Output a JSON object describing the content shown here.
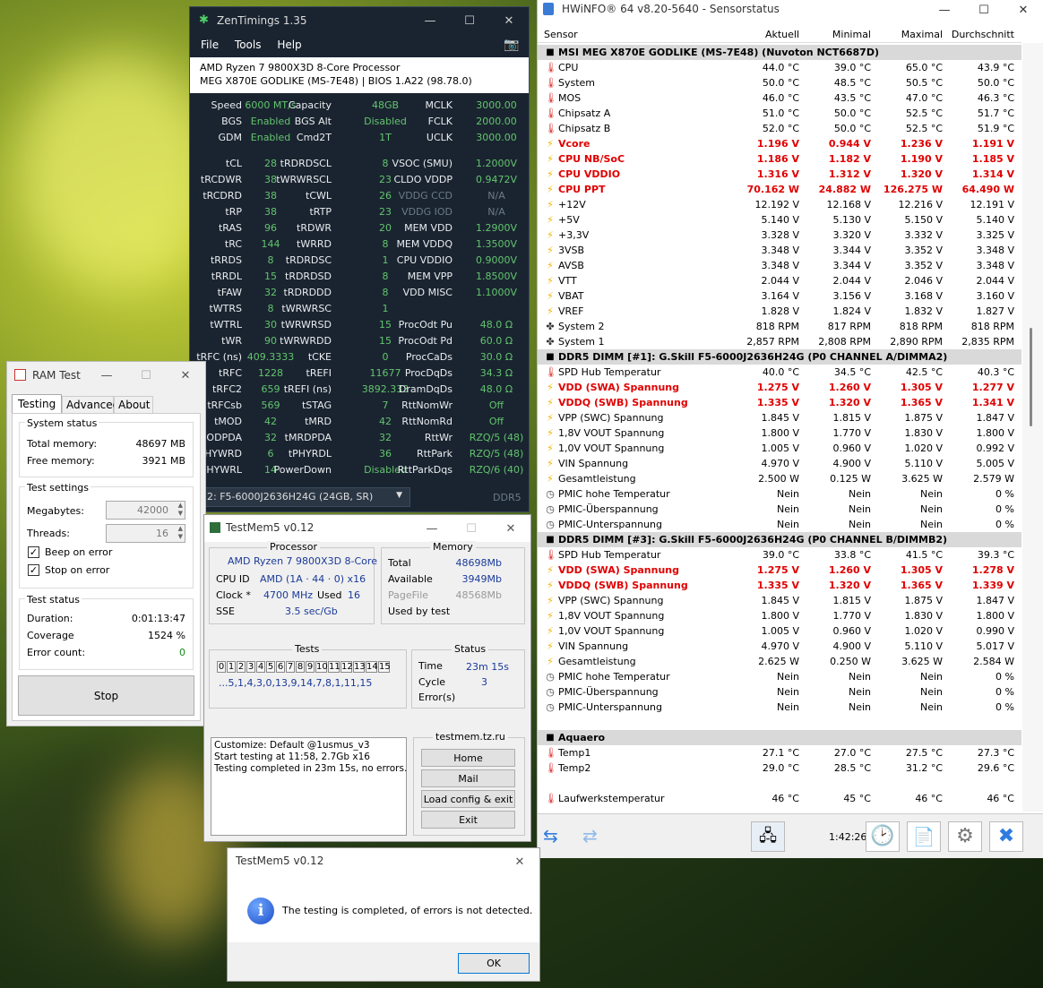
{
  "zen": {
    "title": "ZenTimings 1.35",
    "menu": [
      "File",
      "Tools",
      "Help"
    ],
    "cpu": "AMD Ryzen 7 9800X3D 8-Core Processor",
    "board": "MEG X870E GODLIKE (MS-7E48) | BIOS 1.A22 (98.78.0)",
    "top": [
      [
        "Speed",
        "6000 MT/s",
        "Capacity",
        "48GB",
        "MCLK",
        "3000.00"
      ],
      [
        "BGS",
        "Enabled",
        "BGS Alt",
        "Disabled",
        "FCLK",
        "2000.00"
      ],
      [
        "GDM",
        "Enabled",
        "Cmd2T",
        "1T",
        "UCLK",
        "3000.00"
      ]
    ],
    "timings": [
      [
        "tCL",
        "28",
        "tRDRDSCL",
        "8",
        "VSOC (SMU)",
        "1.2000V"
      ],
      [
        "tRCDWR",
        "38",
        "tWRWRSCL",
        "23",
        "CLDO VDDP",
        "0.9472V"
      ],
      [
        "tRCDRD",
        "38",
        "tCWL",
        "26",
        "VDDG CCD",
        "N/A"
      ],
      [
        "tRP",
        "38",
        "tRTP",
        "23",
        "VDDG IOD",
        "N/A"
      ],
      [
        "tRAS",
        "96",
        "tRDWR",
        "20",
        "MEM VDD",
        "1.2900V"
      ],
      [
        "tRC",
        "144",
        "tWRRD",
        "8",
        "MEM VDDQ",
        "1.3500V"
      ],
      [
        "tRRDS",
        "8",
        "tRDRDSC",
        "1",
        "CPU VDDIO",
        "0.9000V"
      ],
      [
        "tRRDL",
        "15",
        "tRDRDSD",
        "8",
        "MEM VPP",
        "1.8500V"
      ],
      [
        "tFAW",
        "32",
        "tRDRDDD",
        "8",
        "VDD MISC",
        "1.1000V"
      ],
      [
        "tWTRS",
        "8",
        "tWRWRSC",
        "1",
        "",
        ""
      ],
      [
        "tWTRL",
        "30",
        "tWRWRSD",
        "15",
        "ProcOdt Pu",
        "48.0 Ω"
      ],
      [
        "tWR",
        "90",
        "tWRWRDD",
        "15",
        "ProcOdt Pd",
        "60.0 Ω"
      ],
      [
        "tRFC (ns)",
        "409.3333",
        "tCKE",
        "0",
        "ProcCaDs",
        "30.0 Ω"
      ],
      [
        "tRFC",
        "1228",
        "tREFI",
        "11677",
        "ProcDqDs",
        "34.3 Ω"
      ],
      [
        "tRFC2",
        "659",
        "tREFI (ns)",
        "3892.333",
        "DramDqDs",
        "48.0 Ω"
      ],
      [
        "tRFCsb",
        "569",
        "tSTAG",
        "7",
        "RttNomWr",
        "Off"
      ],
      [
        "tMOD",
        "42",
        "tMRD",
        "42",
        "RttNomRd",
        "Off"
      ],
      [
        "tMODPDA",
        "32",
        "tMRDPDA",
        "32",
        "RttWr",
        "RZQ/5 (48)"
      ],
      [
        "tPHYWRD",
        "6",
        "tPHYRDL",
        "36",
        "RttPark",
        "RZQ/5 (48)"
      ],
      [
        "tPHYWRL",
        "14",
        "PowerDown",
        "Disabled",
        "RttParkDqs",
        "RZQ/6 (40)"
      ]
    ],
    "dimm": "2: F5-6000J2636H24G (24GB, SR)",
    "ddr": "DDR5"
  },
  "hw": {
    "title": "HWiNFO® 64 v8.20-5640 - Sensorstatus",
    "cols": [
      "Sensor",
      "Aktuell",
      "Minimal",
      "Maximal",
      "Durchschnitt"
    ],
    "rows": [
      [
        "sec",
        "",
        "MSI MEG X870E GODLIKE (MS-7E48) (Nuvoton NCT6687D)",
        "",
        "",
        "",
        ""
      ],
      [
        "t",
        "therm",
        "CPU",
        "44.0 °C",
        "39.0 °C",
        "65.0 °C",
        "43.9 °C"
      ],
      [
        "t",
        "therm",
        "System",
        "50.0 °C",
        "48.5 °C",
        "50.5 °C",
        "50.0 °C"
      ],
      [
        "t",
        "therm",
        "MOS",
        "46.0 °C",
        "43.5 °C",
        "47.0 °C",
        "46.3 °C"
      ],
      [
        "t",
        "therm",
        "Chipsatz A",
        "51.0 °C",
        "50.0 °C",
        "52.5 °C",
        "51.7 °C"
      ],
      [
        "t",
        "therm",
        "Chipsatz B",
        "52.0 °C",
        "50.0 °C",
        "52.5 °C",
        "51.9 °C"
      ],
      [
        "red",
        "bolt",
        "Vcore",
        "1.196 V",
        "0.944 V",
        "1.236 V",
        "1.191 V"
      ],
      [
        "red",
        "bolt",
        "CPU NB/SoC",
        "1.186 V",
        "1.182 V",
        "1.190 V",
        "1.185 V"
      ],
      [
        "red",
        "bolt",
        "CPU VDDIO",
        "1.316 V",
        "1.312 V",
        "1.320 V",
        "1.314 V"
      ],
      [
        "red",
        "bolt",
        "CPU PPT",
        "70.162 W",
        "24.882 W",
        "126.275 W",
        "64.490 W"
      ],
      [
        "t",
        "bolt",
        "+12V",
        "12.192 V",
        "12.168 V",
        "12.216 V",
        "12.191 V"
      ],
      [
        "t",
        "bolt",
        "+5V",
        "5.140 V",
        "5.130 V",
        "5.150 V",
        "5.140 V"
      ],
      [
        "t",
        "bolt",
        "+3,3V",
        "3.328 V",
        "3.320 V",
        "3.332 V",
        "3.325 V"
      ],
      [
        "t",
        "bolt",
        "3VSB",
        "3.348 V",
        "3.344 V",
        "3.352 V",
        "3.348 V"
      ],
      [
        "t",
        "bolt",
        "AVSB",
        "3.348 V",
        "3.344 V",
        "3.352 V",
        "3.348 V"
      ],
      [
        "t",
        "bolt",
        "VTT",
        "2.044 V",
        "2.044 V",
        "2.046 V",
        "2.044 V"
      ],
      [
        "t",
        "bolt",
        "VBAT",
        "3.164 V",
        "3.156 V",
        "3.168 V",
        "3.160 V"
      ],
      [
        "t",
        "bolt",
        "VREF",
        "1.828 V",
        "1.824 V",
        "1.832 V",
        "1.827 V"
      ],
      [
        "t",
        "fan",
        "System 2",
        "818 RPM",
        "817 RPM",
        "818 RPM",
        "818 RPM"
      ],
      [
        "t",
        "fan",
        "System 1",
        "2,857 RPM",
        "2,808 RPM",
        "2,890 RPM",
        "2,835 RPM"
      ],
      [
        "sec",
        "",
        "DDR5 DIMM [#1]: G.Skill F5-6000J2636H24G (P0 CHANNEL A/DIMMA2)",
        "",
        "",
        "",
        ""
      ],
      [
        "t",
        "therm",
        "SPD Hub Temperatur",
        "40.0 °C",
        "34.5 °C",
        "42.5 °C",
        "40.3 °C"
      ],
      [
        "red",
        "bolt",
        "VDD (SWA) Spannung",
        "1.275 V",
        "1.260 V",
        "1.305 V",
        "1.277 V"
      ],
      [
        "red",
        "bolt",
        "VDDQ (SWB) Spannung",
        "1.335 V",
        "1.320 V",
        "1.365 V",
        "1.341 V"
      ],
      [
        "t",
        "bolt",
        "VPP (SWC) Spannung",
        "1.845 V",
        "1.815 V",
        "1.875 V",
        "1.847 V"
      ],
      [
        "t",
        "bolt",
        "1,8V VOUT Spannung",
        "1.800 V",
        "1.770 V",
        "1.830 V",
        "1.800 V"
      ],
      [
        "t",
        "bolt",
        "1,0V VOUT Spannung",
        "1.005 V",
        "0.960 V",
        "1.020 V",
        "0.992 V"
      ],
      [
        "t",
        "bolt",
        "VIN Spannung",
        "4.970 V",
        "4.900 V",
        "5.110 V",
        "5.005 V"
      ],
      [
        "t",
        "bolt",
        "Gesamtleistung",
        "2.500 W",
        "0.125 W",
        "3.625 W",
        "2.579 W"
      ],
      [
        "t",
        "clock",
        "PMIC hohe Temperatur",
        "Nein",
        "Nein",
        "Nein",
        "0 %"
      ],
      [
        "t",
        "clock",
        "PMIC-Überspannung",
        "Nein",
        "Nein",
        "Nein",
        "0 %"
      ],
      [
        "t",
        "clock",
        "PMIC-Unterspannung",
        "Nein",
        "Nein",
        "Nein",
        "0 %"
      ],
      [
        "sec",
        "",
        "DDR5 DIMM [#3]: G.Skill F5-6000J2636H24G (P0 CHANNEL B/DIMMB2)",
        "",
        "",
        "",
        ""
      ],
      [
        "t",
        "therm",
        "SPD Hub Temperatur",
        "39.0 °C",
        "33.8 °C",
        "41.5 °C",
        "39.3 °C"
      ],
      [
        "red",
        "bolt",
        "VDD (SWA) Spannung",
        "1.275 V",
        "1.260 V",
        "1.305 V",
        "1.278 V"
      ],
      [
        "red",
        "bolt",
        "VDDQ (SWB) Spannung",
        "1.335 V",
        "1.320 V",
        "1.365 V",
        "1.339 V"
      ],
      [
        "t",
        "bolt",
        "VPP (SWC) Spannung",
        "1.845 V",
        "1.815 V",
        "1.875 V",
        "1.847 V"
      ],
      [
        "t",
        "bolt",
        "1,8V VOUT Spannung",
        "1.800 V",
        "1.770 V",
        "1.830 V",
        "1.800 V"
      ],
      [
        "t",
        "bolt",
        "1,0V VOUT Spannung",
        "1.005 V",
        "0.960 V",
        "1.020 V",
        "0.990 V"
      ],
      [
        "t",
        "bolt",
        "VIN Spannung",
        "4.970 V",
        "4.900 V",
        "5.110 V",
        "5.017 V"
      ],
      [
        "t",
        "bolt",
        "Gesamtleistung",
        "2.625 W",
        "0.250 W",
        "3.625 W",
        "2.584 W"
      ],
      [
        "t",
        "clock",
        "PMIC hohe Temperatur",
        "Nein",
        "Nein",
        "Nein",
        "0 %"
      ],
      [
        "t",
        "clock",
        "PMIC-Überspannung",
        "Nein",
        "Nein",
        "Nein",
        "0 %"
      ],
      [
        "t",
        "clock",
        "PMIC-Unterspannung",
        "Nein",
        "Nein",
        "Nein",
        "0 %"
      ],
      [
        "blank",
        "",
        "",
        "",
        "",
        "",
        ""
      ],
      [
        "sec",
        "",
        "Aquaero",
        "",
        "",
        "",
        ""
      ],
      [
        "t",
        "therm",
        "Temp1",
        "27.1 °C",
        "27.0 °C",
        "27.5 °C",
        "27.3 °C"
      ],
      [
        "t",
        "therm",
        "Temp2",
        "29.0 °C",
        "28.5 °C",
        "31.2 °C",
        "29.6 °C"
      ],
      [
        "blank",
        "",
        "",
        "",
        "",
        "",
        ""
      ],
      [
        "t",
        "therm",
        "Laufwerkstemperatur",
        "46 °C",
        "45 °C",
        "46 °C",
        "46 °C"
      ]
    ],
    "timer": "1:42:26"
  },
  "ram": {
    "title": "RAM Test",
    "tabs": [
      "Testing",
      "Advanced",
      "About"
    ],
    "status_title": "System status",
    "total_label": "Total memory:",
    "total": "48697 MB",
    "free_label": "Free memory:",
    "free": "3921 MB",
    "settings_title": "Test settings",
    "mb_label": "Megabytes:",
    "mb": "42000",
    "thr_label": "Threads:",
    "thr": "16",
    "beep": "Beep on error",
    "stop_err": "Stop on error",
    "tstatus_title": "Test status",
    "dur_label": "Duration:",
    "dur": "0:01:13:47",
    "cov_label": "Coverage",
    "cov": "1524 %",
    "err_label": "Error count:",
    "err": "0",
    "stop": "Stop"
  },
  "tm": {
    "title": "TestMem5 v0.12",
    "proc_title": "Processor",
    "proc_name": "AMD Ryzen 7 9800X3D 8-Core",
    "cpuid_label": "CPU ID",
    "cpuid": "AMD  (1A · 44 · 0)  x16",
    "clock_label": "Clock *",
    "clock": "4700 MHz",
    "used_label": "Used",
    "used": "16",
    "sse_label": "SSE",
    "sse": "3.5 sec/Gb",
    "mem_title": "Memory",
    "total_label": "Total",
    "total": "48698Mb",
    "avail_label": "Available",
    "avail": "3949Mb",
    "pf_label": "PageFile",
    "pf": "48568Mb",
    "ubt_label": "Used by test",
    "tests_title": "Tests",
    "tests": [
      "0",
      "1",
      "2",
      "3",
      "4",
      "5",
      "6",
      "7",
      "8",
      "9",
      "10",
      "11",
      "12",
      "13",
      "14",
      "15"
    ],
    "seq": "...5,1,4,3,0,13,9,14,7,8,1,11,15",
    "status_title": "Status",
    "time_label": "Time",
    "time": "23m 15s",
    "cycle_label": "Cycle",
    "cycle": "3",
    "err_label": "Error(s)",
    "log": [
      "Customize: Default @1usmus_v3",
      "Start testing at 11:58, 2.7Gb x16",
      "Testing completed in 23m 15s, no errors."
    ],
    "site": "testmem.tz.ru",
    "home": "Home",
    "mail": "Mail",
    "load": "Load config & exit",
    "exit": "Exit"
  },
  "dlg": {
    "title": "TestMem5 v0.12",
    "msg": "The testing is completed, of errors is not detected.",
    "ok": "OK"
  }
}
